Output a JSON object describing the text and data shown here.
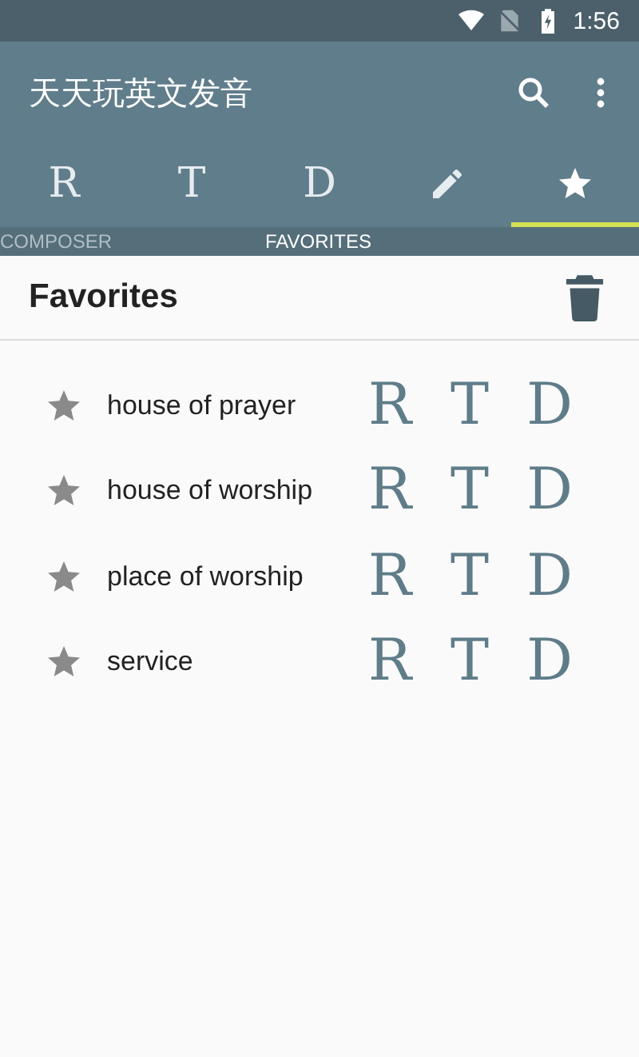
{
  "status_bar": {
    "time": "1:56"
  },
  "app_bar": {
    "title": "天天玩英文发音"
  },
  "tabs": [
    {
      "kind": "text",
      "label": "R",
      "selected": false
    },
    {
      "kind": "text",
      "label": "T",
      "selected": false
    },
    {
      "kind": "text",
      "label": "D",
      "selected": false
    },
    {
      "kind": "pencil",
      "selected": false
    },
    {
      "kind": "star",
      "selected": true
    }
  ],
  "tab_captions": [
    {
      "label": "COMPOSER",
      "selected": false
    },
    {
      "label": "FAVORITES",
      "selected": true
    }
  ],
  "section": {
    "title": "Favorites"
  },
  "favorites": [
    {
      "word": "house of prayer",
      "buttons": [
        "R",
        "T",
        "D"
      ]
    },
    {
      "word": "house of worship",
      "buttons": [
        "R",
        "T",
        "D"
      ]
    },
    {
      "word": "place of worship",
      "buttons": [
        "R",
        "T",
        "D"
      ]
    },
    {
      "word": "service",
      "buttons": [
        "R",
        "T",
        "D"
      ]
    }
  ]
}
